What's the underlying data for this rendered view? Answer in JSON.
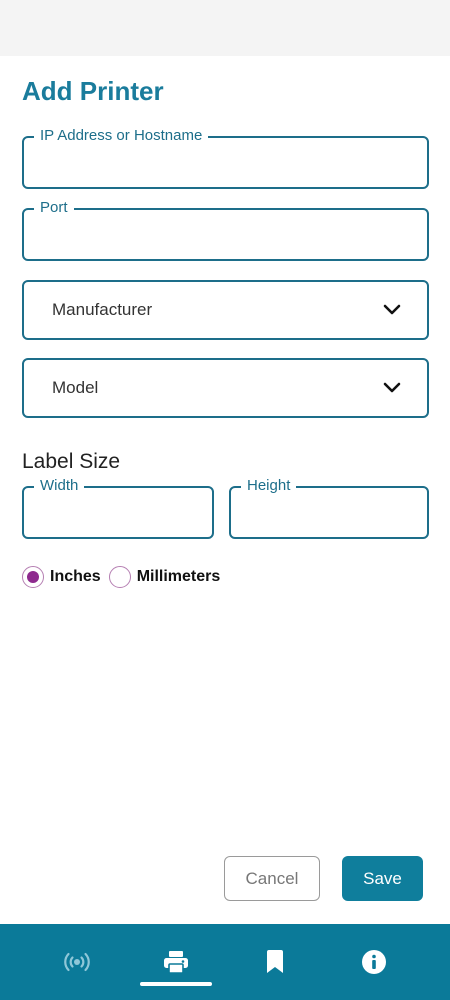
{
  "page": {
    "title": "Add Printer"
  },
  "form": {
    "ip_label": "IP Address or Hostname",
    "ip_value": "",
    "port_label": "Port",
    "port_value": "",
    "manufacturer_placeholder": "Manufacturer",
    "model_placeholder": "Model",
    "label_size_heading": "Label Size",
    "width_label": "Width",
    "width_value": "",
    "height_label": "Height",
    "height_value": ""
  },
  "units": {
    "options": [
      "Inches",
      "Millimeters"
    ],
    "selected": "Inches"
  },
  "actions": {
    "cancel_label": "Cancel",
    "save_label": "Save"
  },
  "nav": {
    "items": [
      {
        "icon": "broadcast-icon",
        "active": false
      },
      {
        "icon": "printer-icon",
        "active": true
      },
      {
        "icon": "bookmark-icon",
        "active": false
      },
      {
        "icon": "info-icon",
        "active": false
      }
    ]
  },
  "colors": {
    "accent": "#1a7c9c",
    "nav_background": "#0b7a99",
    "radio_selected": "#8e2a8e"
  }
}
